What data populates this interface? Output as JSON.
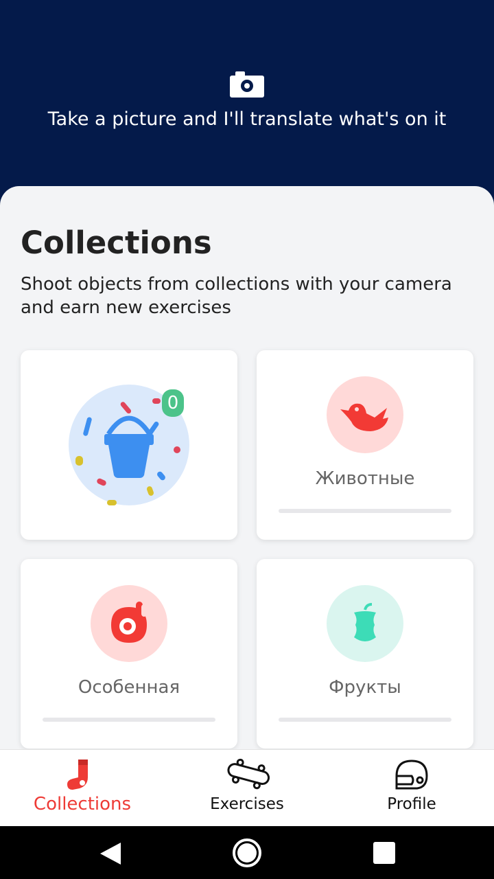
{
  "header": {
    "prompt": "Take a picture and I'll translate what's on it",
    "camera_icon": "camera-icon"
  },
  "collections": {
    "title": "Collections",
    "subtitle": "Shoot objects from collections with your camera and earn new exercises",
    "cards": [
      {
        "label": "",
        "badge": "0",
        "icon": "bucket-icon",
        "color": "#3d8ff0",
        "bg": "#dbe9fb"
      },
      {
        "label": "Животные",
        "icon": "bird-icon",
        "color": "#f23a35",
        "bg": "#ffd9d8",
        "progress": 0
      },
      {
        "label": "Особенная",
        "icon": "special-icon",
        "color": "#f23a35",
        "bg": "#ffd9d8",
        "progress": 0
      },
      {
        "label": "Фрукты",
        "icon": "apple-icon",
        "color": "#3ddcb7",
        "bg": "#daf5ef",
        "progress": 0
      }
    ]
  },
  "tabs": [
    {
      "label": "Collections",
      "icon": "sock-icon",
      "active": true
    },
    {
      "label": "Exercises",
      "icon": "skateboard-icon",
      "active": false
    },
    {
      "label": "Profile",
      "icon": "helmet-icon",
      "active": false
    }
  ],
  "colors": {
    "header_bg": "#041a4a",
    "accent": "#ee3b36",
    "badge": "#4cc38a"
  }
}
